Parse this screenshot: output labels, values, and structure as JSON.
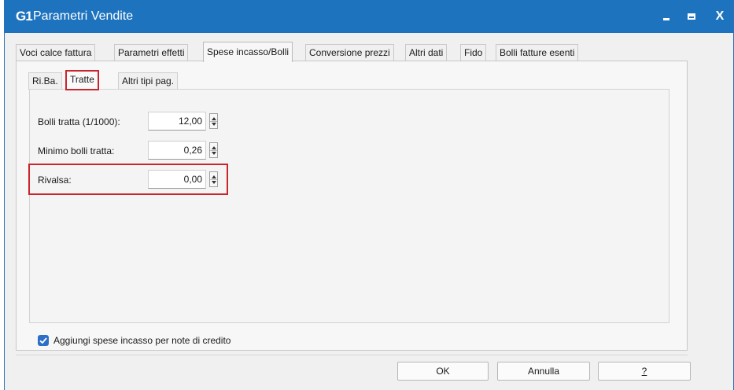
{
  "window": {
    "title": "Parametri Vendite",
    "app_icon": "G1",
    "close": "X"
  },
  "tabs": [
    {
      "label": "Voci calce fattura"
    },
    {
      "label": "Parametri effetti"
    },
    {
      "label": "Spese incasso/Bolli",
      "active": true
    },
    {
      "label": "Conversione prezzi"
    },
    {
      "label": "Altri dati"
    },
    {
      "label": "Fido"
    },
    {
      "label": "Bolli fatture esenti"
    }
  ],
  "subtabs": [
    {
      "label": "Ri.Ba."
    },
    {
      "label": "Tratte",
      "active": true
    },
    {
      "label": "Altri tipi pag."
    }
  ],
  "fields": [
    {
      "label": "Bolli tratta (1/1000):",
      "value": "12,00"
    },
    {
      "label": "Minimo bolli tratta:",
      "value": "0,26"
    },
    {
      "label": "Rivalsa:",
      "value": "0,00"
    }
  ],
  "checkbox": {
    "label": "Aggiungi spese incasso per note di credito",
    "checked": true
  },
  "buttons": {
    "ok": "OK",
    "cancel": "Annulla",
    "help": "?"
  },
  "colors": {
    "titlebar": "#1e73be",
    "highlight": "#c8262c",
    "checkbox": "#2d6fc7"
  }
}
